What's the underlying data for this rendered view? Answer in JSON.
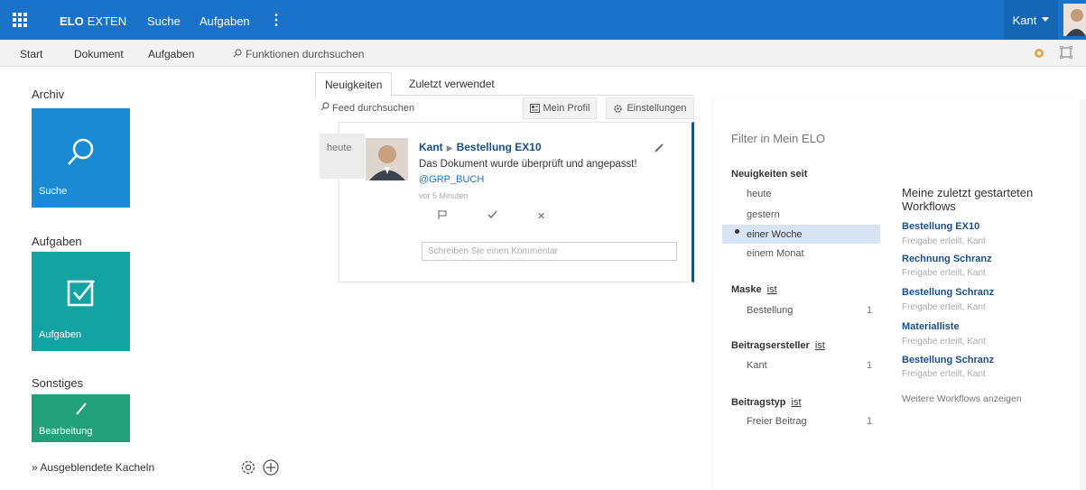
{
  "topbar": {
    "brand_bold": "ELO",
    "brand_light": "EXTEN",
    "nav": [
      "Suche",
      "Aufgaben"
    ],
    "user": "Kant",
    "colors": {
      "bar": "#1a73c8",
      "user_block": "#1565b5"
    }
  },
  "subbar": {
    "items": [
      "Start",
      "Dokument",
      "Aufgaben"
    ],
    "search_label": "Funktionen durchsuchen"
  },
  "left": {
    "section_archiv": "Archiv",
    "tile_suche": "Suche",
    "section_aufgaben": "Aufgaben",
    "tile_aufgaben": "Aufgaben",
    "section_sonstiges": "Sonstiges",
    "tile_bearbeitung": "Bearbeitung",
    "hidden_tiles": "Ausgeblendete Kacheln",
    "colors": {
      "suche": "#1a8ad4",
      "aufgaben": "#14a3a3",
      "bearbeitung": "#22a07a"
    }
  },
  "feed": {
    "tabs": [
      "Neuigkeiten",
      "Zuletzt verwendet"
    ],
    "search_label": "Feed durchsuchen",
    "btn_profile": "Mein Profil",
    "btn_settings": "Einstellungen",
    "date": "heute",
    "post": {
      "author": "Kant",
      "target": "Bestellung EX10",
      "text": "Das Dokument wurde überprüft und angepasst!",
      "mention": "@GRP_BUCH",
      "time": "vor 5 Minuten",
      "comment_placeholder": "Schreiben Sie einen Kommentar"
    }
  },
  "filter": {
    "title": "Filter in Mein ELO",
    "seit_head": "Neuigkeiten seit",
    "seit_items": [
      "heute",
      "gestern",
      "einer Woche",
      "einem Monat"
    ],
    "maske_head": "Maske",
    "ist": "ist",
    "maske_item": "Bestellung",
    "maske_count": "1",
    "ersteller_head": "Beitragsersteller",
    "ersteller_item": "Kant",
    "ersteller_count": "1",
    "typ_head": "Beitragstyp",
    "typ_item": "Freier Beitrag",
    "typ_count": "1"
  },
  "workflows": {
    "title": "Meine zuletzt gestarteten Workflows",
    "items": [
      {
        "name": "Bestellung EX10",
        "sub": "Freigabe erteilt, Kant"
      },
      {
        "name": "Rechnung Schranz",
        "sub": "Freigabe erteilt, Kant"
      },
      {
        "name": "Bestellung Schranz",
        "sub": "Freigabe erteilt, Kant"
      },
      {
        "name": "Materialliste",
        "sub": "Freigabe erteilt, Kant"
      },
      {
        "name": "Bestellung Schranz",
        "sub": "Freigabe erteilt, Kant"
      }
    ],
    "more": "Weitere Workflows anzeigen"
  }
}
